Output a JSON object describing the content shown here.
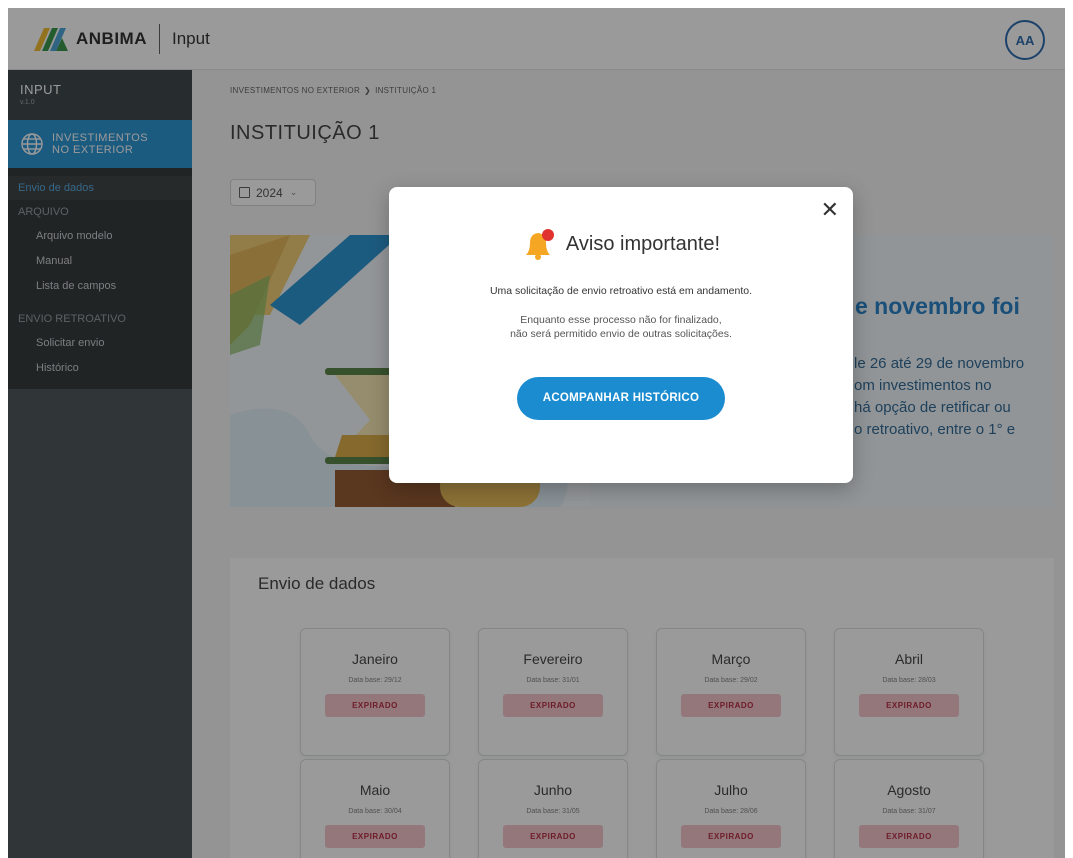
{
  "header": {
    "brand": "ANBIMA",
    "app": "Input",
    "avatar_initials": "AA",
    "brand_colors": [
      "#f3b61f",
      "#2a8f3c",
      "#1b8ccf"
    ]
  },
  "sidebar": {
    "app_title": "INPUT",
    "version": "v.1.0",
    "module": "INVESTIMENTOS NO EXTERIOR",
    "module_icon": "globe-icon",
    "active_item": "Envio de dados",
    "sections": [
      {
        "title": "ARQUIVO",
        "items": [
          "Arquivo modelo",
          "Manual",
          "Lista de campos"
        ]
      },
      {
        "title": "ENVIO RETROATIVO",
        "items": [
          "Solicitar envio",
          "Histórico"
        ]
      }
    ]
  },
  "main": {
    "breadcrumb": [
      "INVESTIMENTOS NO EXTERIOR",
      "INSTITUIÇÃO 1"
    ],
    "page_title": "INSTITUIÇÃO 1",
    "year": "2024",
    "banner": {
      "title_partial": "e novembro foi",
      "body_lines": [
        "le 26 até 29 de novembro",
        "om investimentos no",
        " há opção de retificar ou",
        "o retroativo, entre o 1° e"
      ]
    },
    "data_section": {
      "title": "Envio de dados",
      "months": [
        {
          "name": "Janeiro",
          "base": "Data base: 29/12",
          "status": "EXPIRADO"
        },
        {
          "name": "Fevereiro",
          "base": "Data base: 31/01",
          "status": "EXPIRADO"
        },
        {
          "name": "Março",
          "base": "Data base: 29/02",
          "status": "EXPIRADO"
        },
        {
          "name": "Abril",
          "base": "Data base: 28/03",
          "status": "EXPIRADO"
        },
        {
          "name": "Maio",
          "base": "Data base: 30/04",
          "status": "EXPIRADO"
        },
        {
          "name": "Junho",
          "base": "Data base: 31/05",
          "status": "EXPIRADO"
        },
        {
          "name": "Julho",
          "base": "Data base: 28/06",
          "status": "EXPIRADO"
        },
        {
          "name": "Agosto",
          "base": "Data base: 31/07",
          "status": "EXPIRADO"
        }
      ]
    }
  },
  "modal": {
    "title": "Aviso importante!",
    "message": "Uma solicitação de envio retroativo está em andamento.",
    "note_line1": "Enquanto esse processo não for finalizado,",
    "note_line2": "não será permitido envio de outras solicitações.",
    "button": "ACOMPANHAR HISTÓRICO",
    "close_symbol": "✕",
    "icon": "bell-icon"
  }
}
